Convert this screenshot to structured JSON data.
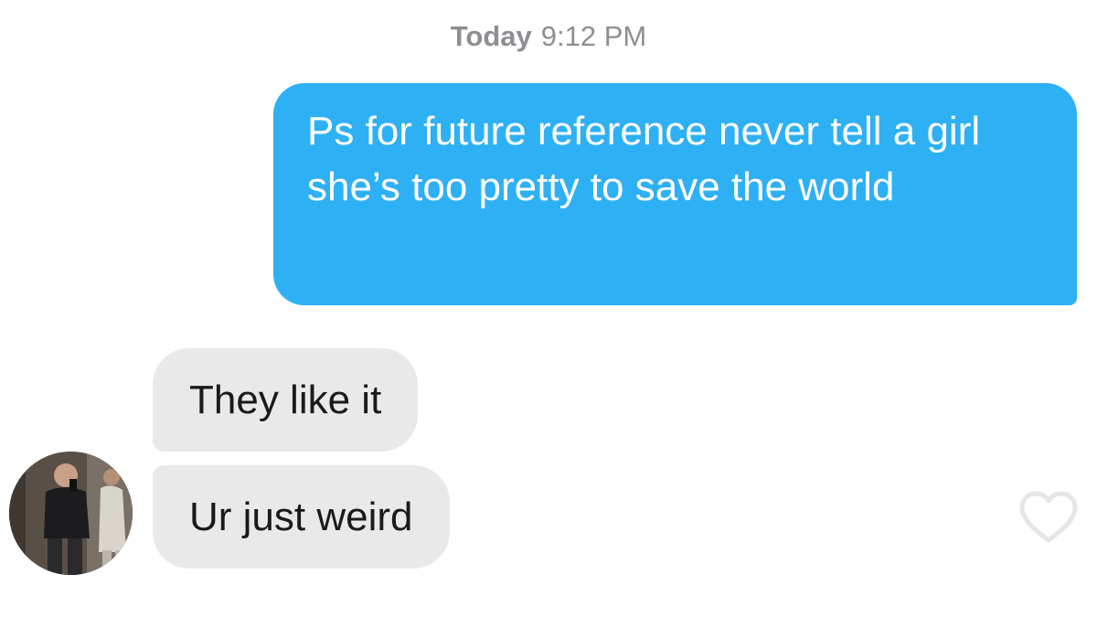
{
  "header": {
    "day": "Today",
    "time": "9:12 PM"
  },
  "messages": [
    {
      "direction": "outgoing",
      "text": "Ps for future reference never tell a girl she’s too pretty to save the world",
      "color": "#2eb0f5"
    },
    {
      "direction": "incoming",
      "text": "They like it",
      "color": "#e9e9ea"
    },
    {
      "direction": "incoming",
      "text": "Ur just weird",
      "color": "#e9e9ea"
    }
  ],
  "icons": {
    "avatar": "contact-avatar",
    "like": "heart-icon"
  }
}
